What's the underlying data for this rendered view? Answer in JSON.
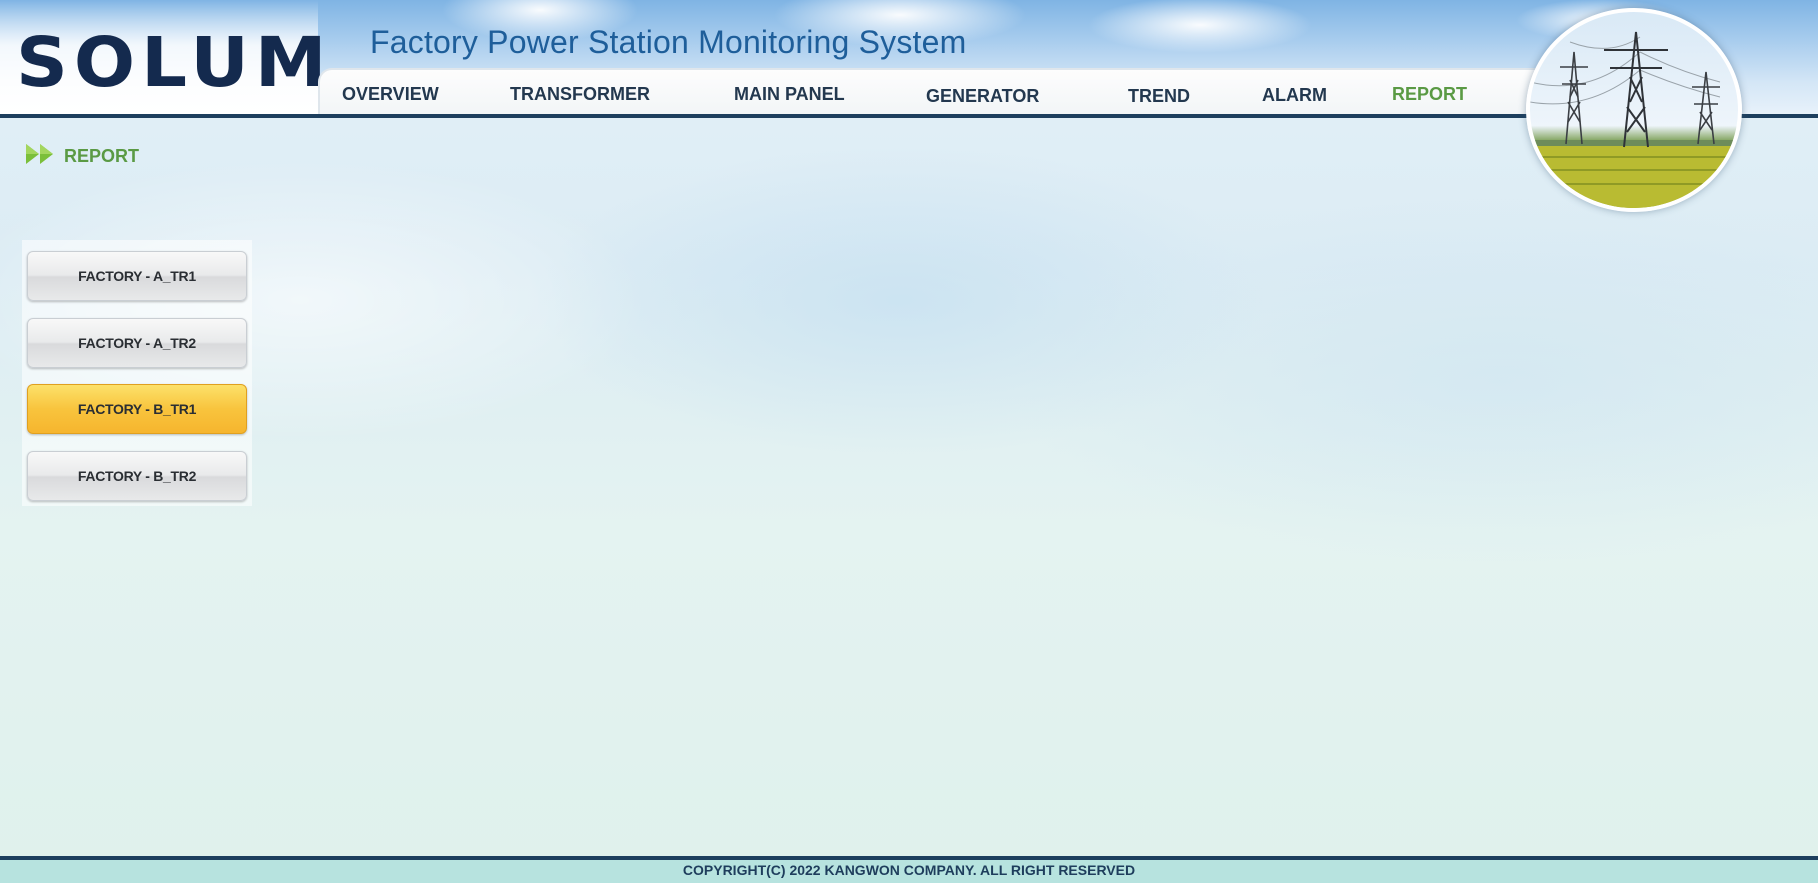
{
  "brand": {
    "logo_text": "SOLUM",
    "system_title": "Factory Power Station Monitoring System"
  },
  "nav": {
    "items": [
      {
        "label": "OVERVIEW"
      },
      {
        "label": "TRANSFORMER"
      },
      {
        "label": "MAIN PANEL"
      },
      {
        "label": "GENERATOR"
      },
      {
        "label": "TREND"
      },
      {
        "label": "ALARM"
      },
      {
        "label": "REPORT",
        "active": true
      }
    ]
  },
  "page": {
    "title": "REPORT",
    "title_icon": "double-chevron-right-icon"
  },
  "report_buttons": [
    {
      "label": "FACTORY - A_TR1"
    },
    {
      "label": "FACTORY - A_TR2"
    },
    {
      "label": "FACTORY - B_TR1",
      "active": true
    },
    {
      "label": "FACTORY - B_TR2"
    }
  ],
  "footer": {
    "copyright": "COPYRIGHT(C) 2022 KANGWON COMPANY. ALL RIGHT RESERVED"
  },
  "colors": {
    "accent_green": "#5a9a44",
    "nav_text": "#23384f",
    "brand_navy": "#142a4e",
    "title_blue": "#1e5e9a",
    "active_button": "#f8c43d"
  }
}
